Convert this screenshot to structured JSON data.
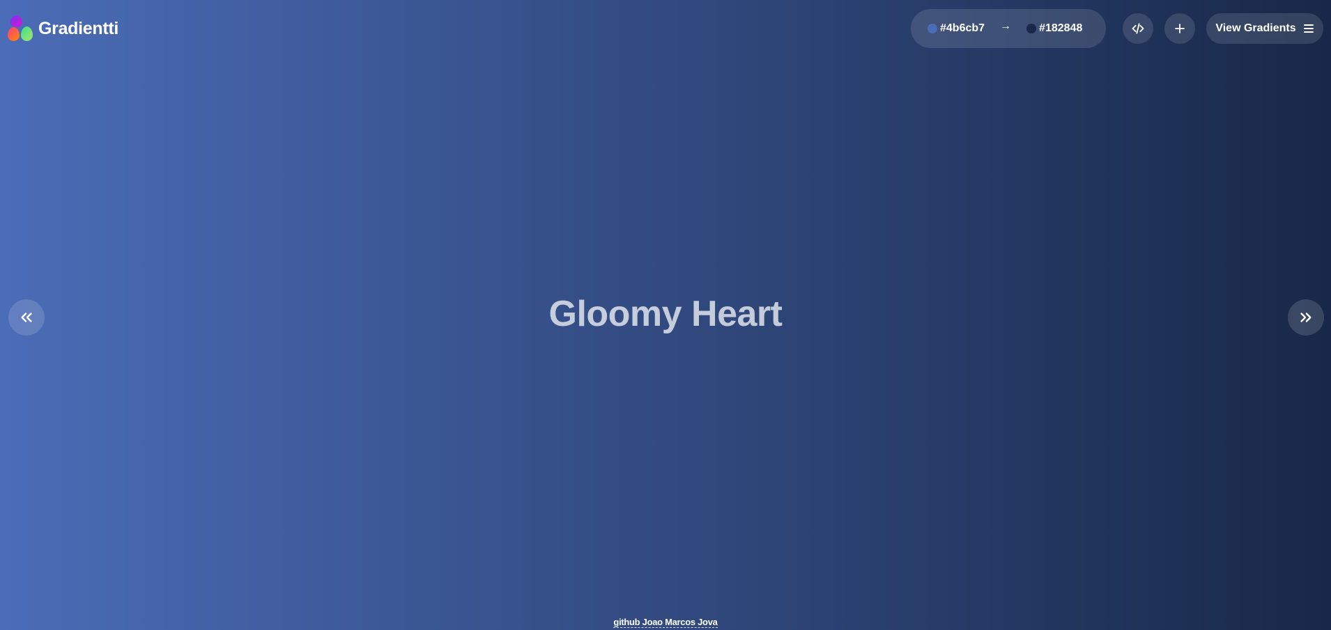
{
  "app": {
    "name": "Gradientti"
  },
  "colors": {
    "start": "#4b6cb7",
    "end": "#182848"
  },
  "color_pill": {
    "start_label": "#4b6cb7",
    "arrow": "→",
    "end_label": "#182848"
  },
  "toolbar": {
    "code_icon": "code-icon",
    "add_icon": "plus-icon",
    "view_label": "View Gradients",
    "view_icon": "menu-icon"
  },
  "navigation": {
    "prev_icon": "chevrons-left-icon",
    "next_icon": "chevrons-right-icon"
  },
  "gradient": {
    "name": "Gloomy Heart"
  },
  "footer": {
    "link_text": "github Joao Marcos Jova"
  }
}
